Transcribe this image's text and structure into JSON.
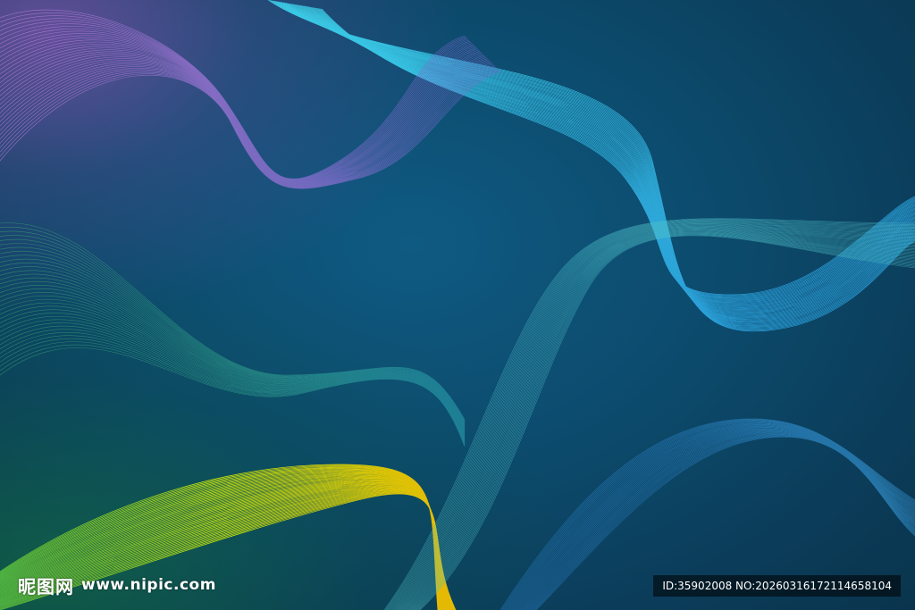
{
  "watermark": {
    "logo_text": "昵图网",
    "site_text": "www.nipic.com",
    "id_text": "ID:35902008 NO:20260316172114658104"
  },
  "palette": {
    "background": "#0d4a6e",
    "cyan": "#2fd9ec",
    "blue": "#2a8fd6",
    "lime": "#c8f000",
    "yellow": "#f2e400",
    "purple": "#b070d8",
    "green": "#30a060"
  }
}
